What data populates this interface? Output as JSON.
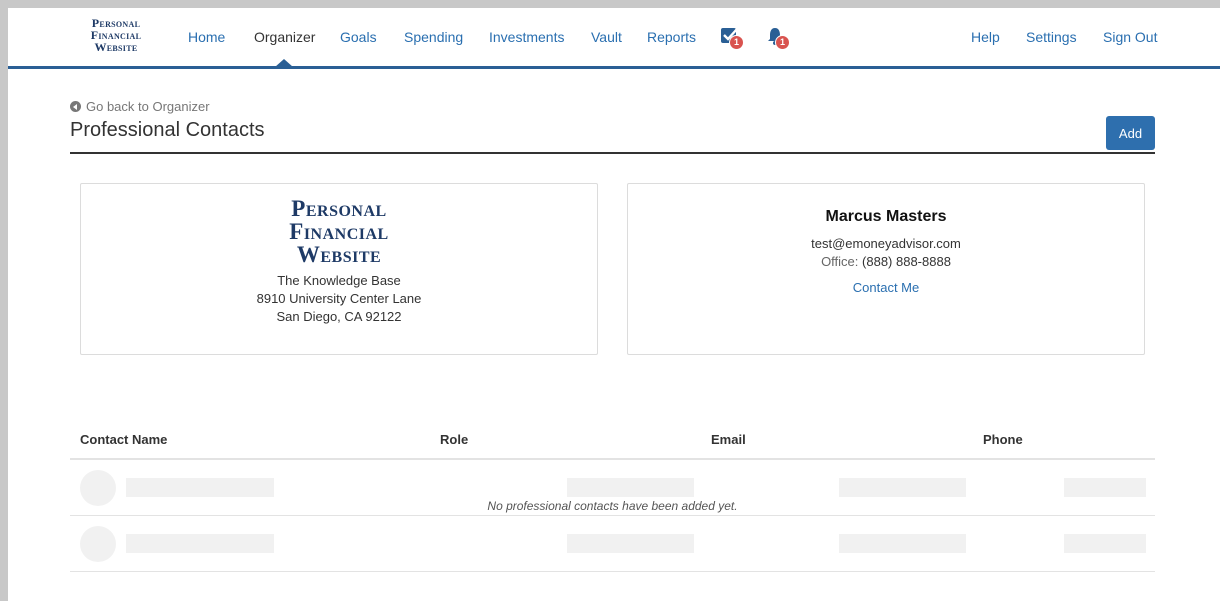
{
  "brand": {
    "logo_lines": [
      "Personal",
      "Financial",
      "Website"
    ],
    "color": "#1e3a66"
  },
  "nav": {
    "items": [
      {
        "label": "Home"
      },
      {
        "label": "Organizer",
        "active": true
      },
      {
        "label": "Goals"
      },
      {
        "label": "Spending"
      },
      {
        "label": "Investments"
      },
      {
        "label": "Vault"
      },
      {
        "label": "Reports"
      }
    ],
    "tasks_badge": "1",
    "alerts_badge": "1",
    "right": [
      {
        "label": "Help"
      },
      {
        "label": "Settings"
      },
      {
        "label": "Sign Out"
      }
    ],
    "accent": "#2a5f95"
  },
  "page": {
    "back_label": "Go back to Organizer",
    "title": "Professional Contacts",
    "add_label": "Add"
  },
  "firm": {
    "logo_lines": [
      "Personal",
      "Financial",
      "Website"
    ],
    "name": "The Knowledge Base",
    "address1": "8910 University Center Lane",
    "address2": "San Diego, CA 92122"
  },
  "advisor": {
    "name": "Marcus Masters",
    "email": "test@emoneyadvisor.com",
    "phone_label": "Office:",
    "phone": "(888) 888-8888",
    "contact_label": "Contact Me"
  },
  "table": {
    "columns": [
      "Contact Name",
      "Role",
      "Email",
      "Phone"
    ],
    "empty_message": "No professional contacts have been added yet."
  }
}
